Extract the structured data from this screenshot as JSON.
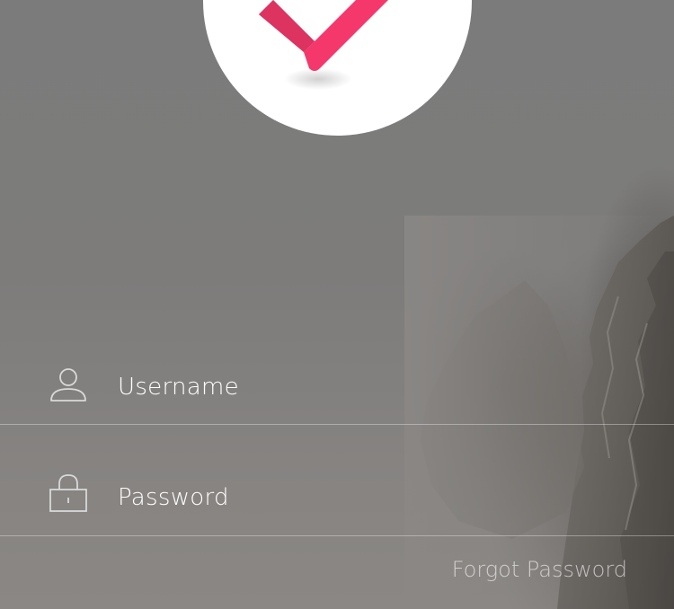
{
  "logo": {
    "icon": "checkmark-icon",
    "accent_color": "#f5386b",
    "shadow_color": "#c9305a"
  },
  "form": {
    "username": {
      "icon": "user-icon",
      "placeholder": "Username"
    },
    "password": {
      "icon": "lock-icon",
      "placeholder": "Password"
    },
    "forgot_password_label": "Forgot Password"
  }
}
